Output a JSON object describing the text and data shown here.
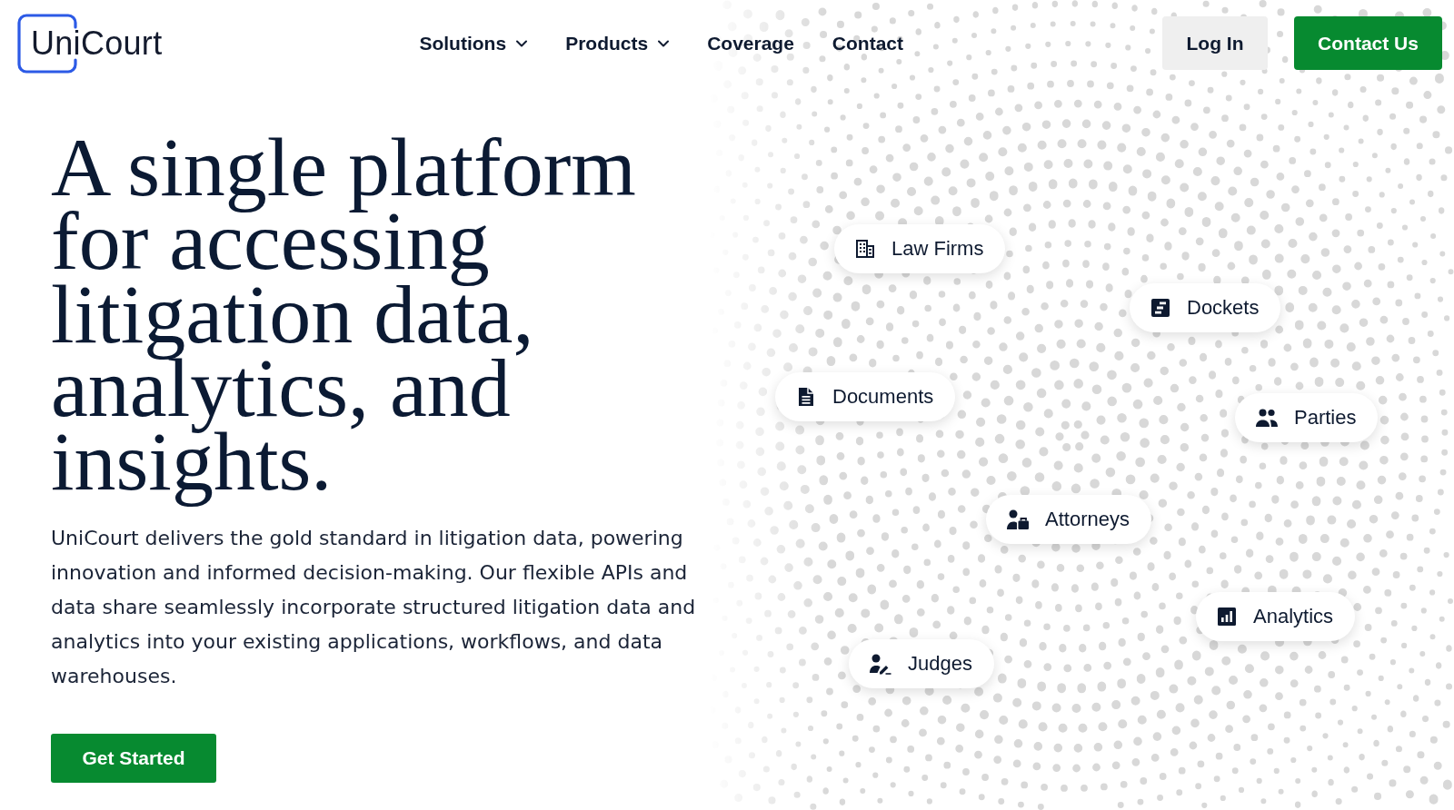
{
  "header": {
    "logo": "UniCourt",
    "nav": [
      {
        "label": "Solutions",
        "dropdown": true
      },
      {
        "label": "Products",
        "dropdown": true
      },
      {
        "label": "Coverage",
        "dropdown": false
      },
      {
        "label": "Contact",
        "dropdown": false
      }
    ],
    "buttons": [
      {
        "label": "Log In",
        "kind": "secondary"
      },
      {
        "label": "Contact Us",
        "kind": "primary"
      }
    ]
  },
  "hero": {
    "heading": "A single platform for accessing litigation data, analytics, and insights.",
    "description": "UniCourt delivers the gold standard in litigation data, powering innovation and informed decision-making. Our flexible APIs and data share seamlessly incorporate structured litigation data and analytics into your existing applications, workflows, and data warehouses.",
    "cta": "Get Started"
  },
  "data_types": [
    "Law Firms",
    "Dockets",
    "Documents",
    "Parties",
    "Attorneys",
    "Analytics",
    "Judges"
  ]
}
